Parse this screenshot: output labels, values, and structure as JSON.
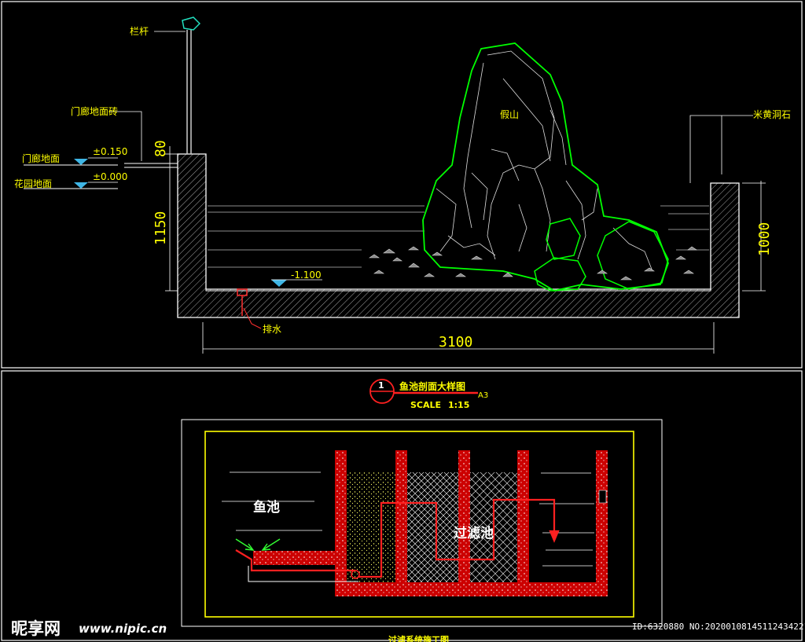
{
  "section": {
    "labels": {
      "railing": "栏杆",
      "door_ground_paving": "门廊地面砖",
      "door_ground": "门廊地面",
      "garden_ground": "花园地面",
      "rockery": "假山",
      "rice_stone": "米黄洞石",
      "drain": "排水"
    },
    "levels": {
      "door_level": "±0.150",
      "garden_level": "±0.000",
      "water_bottom": "-1.100"
    },
    "dimensions": {
      "curb": "80",
      "left_height": "1150",
      "right_height": "1000",
      "width": "3100"
    }
  },
  "title_block": {
    "number": "1",
    "title": "鱼池剖面大样图",
    "sheet": "A3",
    "scale_label": "SCALE",
    "scale_value": "1:15"
  },
  "plan": {
    "labels": {
      "fish_pond": "鱼池",
      "filter_pond": "过滤池"
    },
    "bottom_caption": "过滤系统施工图"
  },
  "watermark": {
    "logo_text": "昵享网",
    "url": "www.nipic.cn",
    "id_text": "ID:6320880 NO:20200108145112434221"
  },
  "colors": {
    "background": "#000000",
    "annotation": "#ffff00",
    "outline": "#ffffff",
    "rockery": "#00ff00",
    "pipe": "#ff0000",
    "water_marker": "#3fb6e6"
  }
}
